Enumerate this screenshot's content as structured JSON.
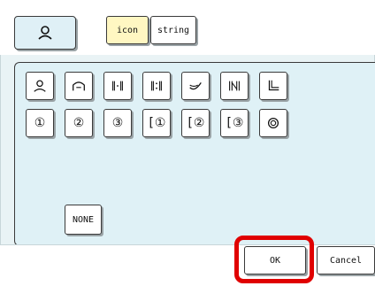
{
  "header": {
    "icon_name": "person-icon",
    "tabs": [
      {
        "label": "icon",
        "active": true
      },
      {
        "label": "string",
        "active": false
      }
    ]
  },
  "icon_grid": {
    "row1": [
      "person-icon",
      "arch-icon",
      "bracket-dot-icon",
      "bracket-dots-icon",
      "curve-icon",
      "bars-icon",
      "corner-icon"
    ],
    "row2": [
      "circle-1-icon",
      "circle-2-icon",
      "circle-3-icon",
      "bracket-circle-1-icon",
      "bracket-circle-2-icon",
      "bracket-circle-3-icon",
      "swirl-icon"
    ]
  },
  "none_label": "NONE",
  "footer": {
    "ok_label": "OK",
    "cancel_label": "Cancel"
  },
  "colors": {
    "panel": "#e9f3f5",
    "content": "#dff1f6",
    "active_tab": "#fff7c2",
    "highlight": "#e00000"
  }
}
